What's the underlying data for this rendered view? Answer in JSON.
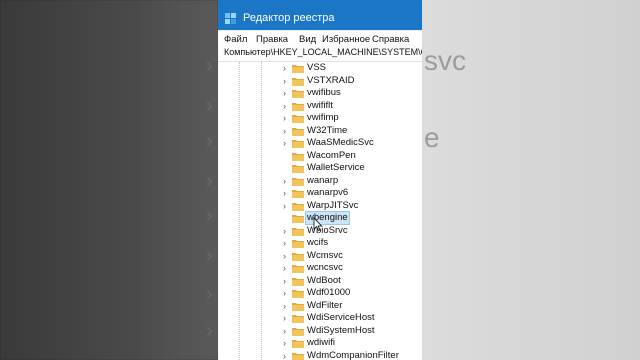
{
  "window": {
    "title": "Редактор реестра",
    "menu": [
      "Файл",
      "Правка",
      "Вид",
      "Избранное",
      "Справка"
    ],
    "address": "Компьютер\\HKEY_LOCAL_MACHINE\\SYSTEM\\CurrentControlSet\\Services"
  },
  "background": {
    "right_texts": [
      "svc",
      "e"
    ]
  },
  "tree": {
    "selected": "wbengine",
    "items": [
      {
        "label": "VSS",
        "expandable": true
      },
      {
        "label": "VSTXRAID",
        "expandable": true
      },
      {
        "label": "vwifibus",
        "expandable": true
      },
      {
        "label": "vwififlt",
        "expandable": true
      },
      {
        "label": "vwifimp",
        "expandable": true
      },
      {
        "label": "W32Time",
        "expandable": true
      },
      {
        "label": "WaaSMedicSvc",
        "expandable": true
      },
      {
        "label": "WacomPen",
        "expandable": false
      },
      {
        "label": "WalletService",
        "expandable": false
      },
      {
        "label": "wanarp",
        "expandable": true
      },
      {
        "label": "wanarpv6",
        "expandable": true
      },
      {
        "label": "WarpJITSvc",
        "expandable": true
      },
      {
        "label": "wbengine",
        "expandable": false
      },
      {
        "label": "WbioSrvc",
        "expandable": true
      },
      {
        "label": "wcifs",
        "expandable": true
      },
      {
        "label": "Wcmsvc",
        "expandable": true
      },
      {
        "label": "wcncsvc",
        "expandable": true
      },
      {
        "label": "WdBoot",
        "expandable": true
      },
      {
        "label": "Wdf01000",
        "expandable": true
      },
      {
        "label": "WdFilter",
        "expandable": true
      },
      {
        "label": "WdiServiceHost",
        "expandable": true
      },
      {
        "label": "WdiSystemHost",
        "expandable": true
      },
      {
        "label": "wdiwifi",
        "expandable": true
      },
      {
        "label": "WdmCompanionFilter",
        "expandable": true
      }
    ]
  },
  "colors": {
    "titlebar": "#1b76c7",
    "folder": "#f2c55c",
    "selection": "#cce4f7"
  }
}
